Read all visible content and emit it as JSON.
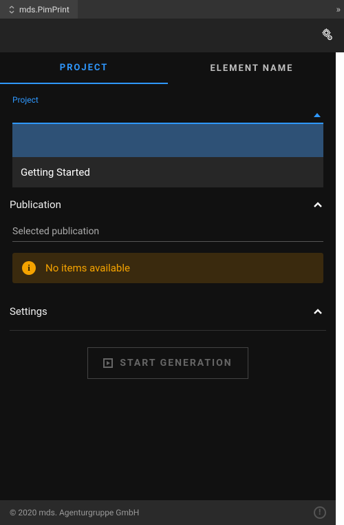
{
  "title": "mds.PimPrint",
  "tabs": {
    "project": "PROJECT",
    "element": "ELEMENT NAME"
  },
  "project": {
    "label": "Project",
    "options": {
      "selected": "",
      "gettingStarted": "Getting Started"
    }
  },
  "publication": {
    "heading": "Publication",
    "selectedLabel": "Selected publication",
    "alert": "No items available"
  },
  "settings": {
    "heading": "Settings"
  },
  "action": {
    "startGeneration": "START GENERATION"
  },
  "footer": {
    "copyright": "© 2020 mds. Agenturgruppe GmbH"
  }
}
